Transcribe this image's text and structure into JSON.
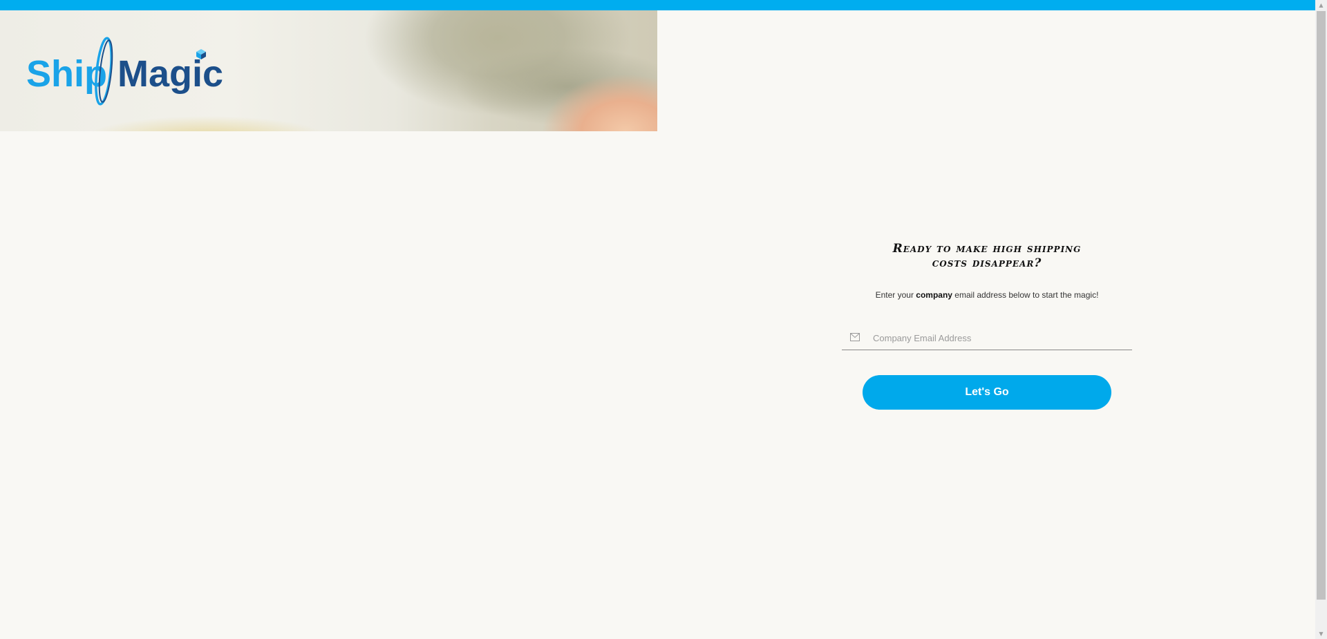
{
  "brand": {
    "name_part1": "Ship",
    "name_part2": "Magic",
    "colors": {
      "light_blue": "#1aa3e8",
      "dark_blue": "#1c4f8a",
      "accent": "#00adef"
    }
  },
  "signup": {
    "headline_line1": "Ready to make high shipping",
    "headline_line2": "costs disappear?",
    "subtext_before": "Enter your ",
    "subtext_bold": "company",
    "subtext_after": " email address below to start the magic!",
    "email_placeholder": "Company Email Address",
    "email_value": "",
    "email_icon": "mail-icon",
    "cta_label": "Let's Go"
  },
  "scrollbar": {
    "up_glyph": "▲",
    "down_glyph": "▼"
  }
}
